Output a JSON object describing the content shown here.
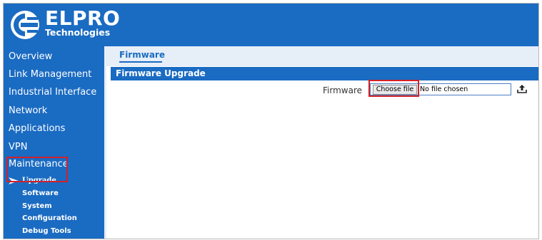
{
  "header": {
    "brand_name": "ELPRO",
    "brand_sub": "Technologies",
    "logo_icon": "elpro-logo-icon",
    "bg_color": "#1a6bc2"
  },
  "sidebar": {
    "items": [
      {
        "label": "Overview"
      },
      {
        "label": "Link Management"
      },
      {
        "label": "Industrial Interface"
      },
      {
        "label": "Network"
      },
      {
        "label": "Applications"
      },
      {
        "label": "VPN"
      },
      {
        "label": "Maintenance"
      }
    ],
    "subitems": [
      {
        "label": "Upgrade",
        "active": true
      },
      {
        "label": "Software"
      },
      {
        "label": "System"
      },
      {
        "label": "Configuration"
      },
      {
        "label": "Debug Tools"
      }
    ],
    "active_marker_icon": "arrow-right-icon"
  },
  "main": {
    "tab_label": "Firmware",
    "section_title": "Firmware Upgrade",
    "field_label": "Firmware",
    "choose_label": "Choose file",
    "file_status": "No file chosen",
    "upload_icon": "upload-icon"
  },
  "highlight_color": "#d2202a"
}
